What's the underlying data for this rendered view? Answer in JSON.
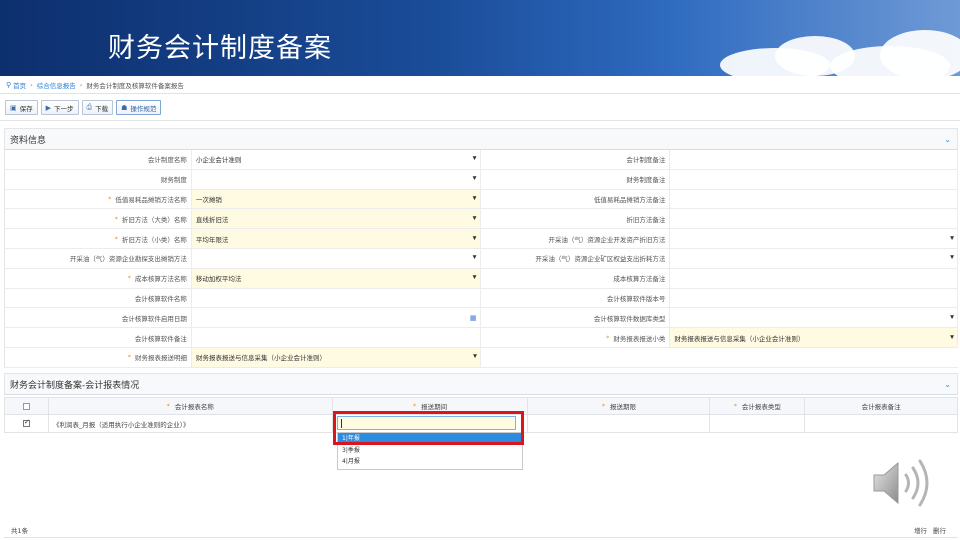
{
  "header": {
    "title": "财务会计制度备案"
  },
  "breadcrumb": {
    "home": "首页",
    "section": "综合信息报告",
    "current": "财务会计制度及核算软件备案报告"
  },
  "toolbar": {
    "save": "保存",
    "next": "下一步",
    "download": "下载",
    "guide": "操作规范"
  },
  "info_panel": {
    "title": "资料信息"
  },
  "form_rows": [
    {
      "l1": "会计制度名称",
      "r1": false,
      "v1": "小企业会计准则",
      "t1": "select",
      "l2": "会计制度备注",
      "r2": false,
      "v2": "",
      "t2": "text"
    },
    {
      "l1": "财务制度",
      "r1": false,
      "v1": "",
      "t1": "select",
      "l2": "财务制度备注",
      "r2": false,
      "v2": "",
      "t2": "text"
    },
    {
      "l1": "低值易耗品摊销方法名称",
      "r1": true,
      "v1": "一次摊销",
      "t1": "select",
      "l2": "低值易耗品摊销方法备注",
      "r2": false,
      "v2": "",
      "t2": "text"
    },
    {
      "l1": "折旧方法（大类）名称",
      "r1": true,
      "v1": "直线折旧法",
      "t1": "select",
      "l2": "折旧方法备注",
      "r2": false,
      "v2": "",
      "t2": "text"
    },
    {
      "l1": "折旧方法（小类）名称",
      "r1": true,
      "v1": "平均年限法",
      "t1": "select",
      "l2": "开采油（气）资源企业开发资产折旧方法",
      "r2": false,
      "v2": "",
      "t2": "select"
    },
    {
      "l1": "开采油（气）资源企业勘探支出摊销方法",
      "r1": false,
      "v1": "",
      "t1": "select",
      "l2": "开采油（气）资源企业矿区权益支出折耗方法",
      "r2": false,
      "v2": "",
      "t2": "select"
    },
    {
      "l1": "成本核算方法名称",
      "r1": true,
      "v1": "移动加权平均法",
      "t1": "select",
      "l2": "成本核算方法备注",
      "r2": false,
      "v2": "",
      "t2": "text"
    },
    {
      "l1": "会计核算软件名称",
      "r1": false,
      "v1": "",
      "t1": "text",
      "l2": "会计核算软件版本号",
      "r2": false,
      "v2": "",
      "t2": "text"
    },
    {
      "l1": "会计核算软件启用日期",
      "r1": false,
      "v1": "",
      "t1": "date",
      "l2": "会计核算软件数据库类型",
      "r2": false,
      "v2": "",
      "t2": "select"
    },
    {
      "l1": "会计核算软件备注",
      "r1": false,
      "v1": "",
      "t1": "text",
      "l2": "财务报表报送小类",
      "r2": true,
      "v2": "财务报表报送与信息采集（小企业会计准则）",
      "t2": "select"
    },
    {
      "l1": "财务报表报送明细",
      "r1": true,
      "v1": "财务报表报送与信息采集（小企业会计准则）",
      "t1": "select",
      "l2": null
    }
  ],
  "report_panel": {
    "title": "财务会计制度备案-会计报表情况"
  },
  "table": {
    "headers": [
      "会计报表名称",
      "报送期间",
      "报送期限",
      "会计报表类型",
      "会计报表备注"
    ],
    "header_required": [
      true,
      true,
      true,
      true,
      false
    ],
    "rows": [
      {
        "checked": true,
        "name": "《利润表_月报（适用执行小企业准则的企业）》"
      }
    ]
  },
  "dropdown": {
    "options": [
      "1|年报",
      "3|季报",
      "4|月报"
    ],
    "selected_index": 0
  },
  "footer": {
    "count": "共1条",
    "add_row": "增行",
    "del_row": "删行"
  },
  "colors": {
    "banner": "#1a4c98",
    "required": "#f29222",
    "selected": "#2d8be0",
    "highlight": "#d9161c"
  }
}
